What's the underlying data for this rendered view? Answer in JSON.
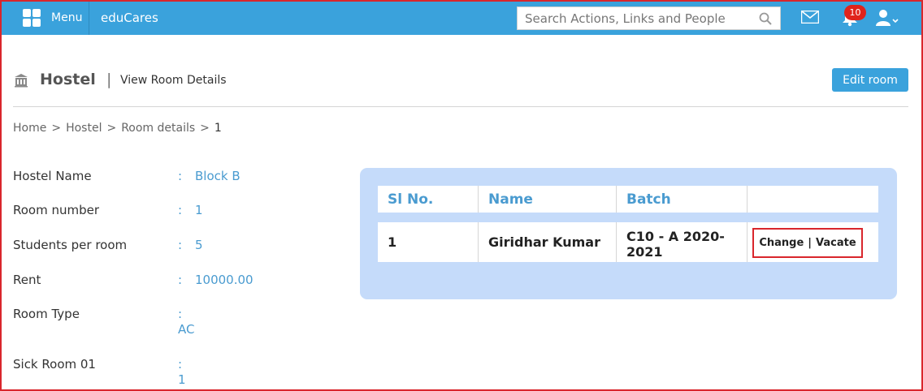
{
  "topbar": {
    "menu_label": "Menu",
    "brand": "eduCares",
    "search_placeholder": "Search Actions, Links and People",
    "notification_count": "10",
    "accent_color": "#3aa2dc"
  },
  "header": {
    "title": "Hostel",
    "subtitle": "View Room Details",
    "edit_button": "Edit room"
  },
  "breadcrumb": [
    "Home",
    "Hostel",
    "Room details",
    "1"
  ],
  "details": [
    {
      "label": "Hostel Name",
      "value": "Block B"
    },
    {
      "label": "Room number",
      "value": "1"
    },
    {
      "label": "Students per room",
      "value": "5"
    },
    {
      "label": "Rent",
      "value": "10000.00"
    },
    {
      "label": "Room Type",
      "value": "AC"
    },
    {
      "label": "Sick Room 01",
      "value": "1"
    }
  ],
  "table": {
    "headers": [
      "Sl No.",
      "Name",
      "Batch",
      ""
    ],
    "rows": [
      {
        "sl": "1",
        "name": "Giridhar Kumar",
        "batch_line1": "C10 - A 2020-",
        "batch_line2": "2021",
        "change": "Change",
        "vacate": "Vacate"
      }
    ]
  },
  "icons": [
    "grid-icon",
    "search-icon",
    "mail-icon",
    "bell-icon",
    "user-icon",
    "building-icon"
  ]
}
